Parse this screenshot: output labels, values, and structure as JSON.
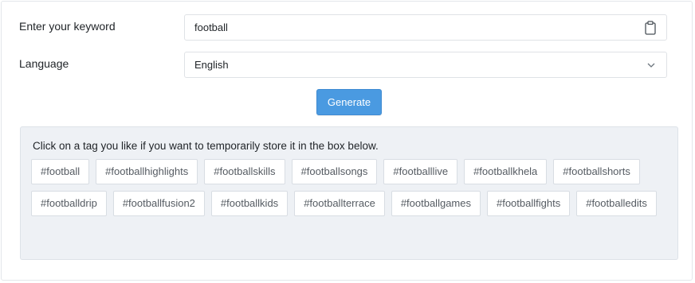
{
  "form": {
    "keyword_label": "Enter your keyword",
    "keyword_value": "football",
    "language_label": "Language",
    "language_value": "English",
    "generate_label": "Generate"
  },
  "tags_panel": {
    "instruction": "Click on a tag you like if you want to temporarily store it in the box below.",
    "tags": [
      "#football",
      "#footballhighlights",
      "#footballskills",
      "#footballsongs",
      "#footballlive",
      "#footballkhela",
      "#footballshorts",
      "#footballdrip",
      "#footballfusion2",
      "#footballkids",
      "#footballterrace",
      "#footballgames",
      "#footballfights",
      "#footballedits"
    ]
  },
  "colors": {
    "accent": "#4a9ae1",
    "panel_bg": "#eef1f5",
    "border": "#dfe2e6"
  },
  "icons": {
    "clipboard": "clipboard-icon",
    "chevron": "chevron-down-icon"
  }
}
